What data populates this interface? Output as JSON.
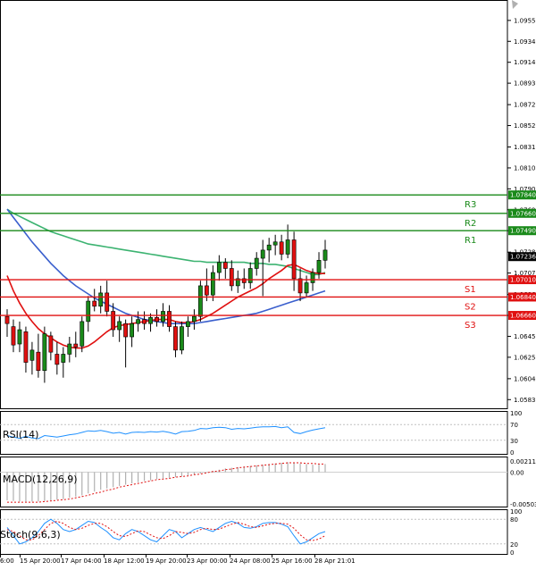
{
  "chart_data": {
    "type": "candlestick",
    "instrument_scale": "EURUSD",
    "main": {
      "ylim": [
        1.0575,
        1.0975
      ],
      "yticks": [
        "1.09550",
        "1.09345",
        "1.09140",
        "1.08935",
        "1.08725",
        "1.08520",
        "1.08310",
        "1.08105",
        "1.07900",
        "1.07695",
        "1.07490",
        "1.07280",
        "1.07075",
        "1.06865",
        "1.06660",
        "1.06455",
        "1.06250",
        "1.06040",
        "1.05835"
      ],
      "levels": [
        {
          "label": "R3",
          "value": 1.0784,
          "tag": "1.07840",
          "color": "#1a8a1a"
        },
        {
          "label": "R2",
          "value": 1.0766,
          "tag": "1.07660",
          "color": "#1a8a1a"
        },
        {
          "label": "R1",
          "value": 1.0749,
          "tag": "1.07490",
          "color": "#1a8a1a"
        },
        {
          "label": "S1",
          "value": 1.0701,
          "tag": "1.07010",
          "color": "#e01010"
        },
        {
          "label": "S2",
          "value": 1.0684,
          "tag": "1.06840",
          "color": "#e01010"
        },
        {
          "label": "S3",
          "value": 1.0666,
          "tag": "1.06660",
          "color": "#e01010"
        }
      ],
      "current_price": "1.07236",
      "candles": [
        [
          1.0665,
          1.0672,
          1.0645,
          1.0658
        ],
        [
          1.0655,
          1.0662,
          1.063,
          1.0637
        ],
        [
          1.0638,
          1.066,
          1.063,
          1.0652
        ],
        [
          1.065,
          1.0655,
          1.061,
          1.062
        ],
        [
          1.0622,
          1.064,
          1.0608,
          1.0632
        ],
        [
          1.063,
          1.0648,
          1.0605,
          1.0612
        ],
        [
          1.0612,
          1.0655,
          1.06,
          1.0648
        ],
        [
          1.0646,
          1.065,
          1.0622,
          1.063
        ],
        [
          1.0628,
          1.064,
          1.0608,
          1.0618
        ],
        [
          1.062,
          1.0635,
          1.0605,
          1.0628
        ],
        [
          1.0628,
          1.0645,
          1.062,
          1.0638
        ],
        [
          1.0638,
          1.065,
          1.0625,
          1.0635
        ],
        [
          1.0636,
          1.0665,
          1.063,
          1.066
        ],
        [
          1.066,
          1.0685,
          1.065,
          1.068
        ],
        [
          1.068,
          1.0692,
          1.067,
          1.0675
        ],
        [
          1.0675,
          1.0695,
          1.0668,
          1.0688
        ],
        [
          1.0688,
          1.07,
          1.0665,
          1.067
        ],
        [
          1.067,
          1.0678,
          1.0645,
          1.0652
        ],
        [
          1.0652,
          1.0665,
          1.064,
          1.066
        ],
        [
          1.0658,
          1.0662,
          1.0615,
          1.0645
        ],
        [
          1.0645,
          1.0665,
          1.0635,
          1.0658
        ],
        [
          1.0658,
          1.067,
          1.065,
          1.0662
        ],
        [
          1.0662,
          1.067,
          1.0652,
          1.0658
        ],
        [
          1.0658,
          1.0668,
          1.065,
          1.0664
        ],
        [
          1.0664,
          1.0672,
          1.0655,
          1.066
        ],
        [
          1.066,
          1.0678,
          1.0655,
          1.067
        ],
        [
          1.067,
          1.0676,
          1.065,
          1.0655
        ],
        [
          1.0655,
          1.066,
          1.0625,
          1.0632
        ],
        [
          1.0632,
          1.066,
          1.0628,
          1.0655
        ],
        [
          1.0655,
          1.0665,
          1.0645,
          1.066
        ],
        [
          1.066,
          1.0672,
          1.0652,
          1.0665
        ],
        [
          1.0665,
          1.07,
          1.066,
          1.0695
        ],
        [
          1.0695,
          1.0712,
          1.068,
          1.0686
        ],
        [
          1.0686,
          1.0715,
          1.068,
          1.0708
        ],
        [
          1.0708,
          1.0725,
          1.07,
          1.0718
        ],
        [
          1.0718,
          1.0722,
          1.0702,
          1.0712
        ],
        [
          1.0712,
          1.072,
          1.069,
          1.0695
        ],
        [
          1.0695,
          1.071,
          1.0688,
          1.0702
        ],
        [
          1.0702,
          1.0712,
          1.0692,
          1.0698
        ],
        [
          1.0698,
          1.0718,
          1.0692,
          1.0712
        ],
        [
          1.0712,
          1.0728,
          1.0705,
          1.0722
        ],
        [
          1.0722,
          1.074,
          1.0685,
          1.073
        ],
        [
          1.073,
          1.0742,
          1.0718,
          1.0735
        ],
        [
          1.0735,
          1.0745,
          1.0725,
          1.0738
        ],
        [
          1.0738,
          1.0745,
          1.072,
          1.0726
        ],
        [
          1.0726,
          1.0755,
          1.0722,
          1.074
        ],
        [
          1.074,
          1.0748,
          1.069,
          1.0702
        ],
        [
          1.0702,
          1.0712,
          1.068,
          1.0688
        ],
        [
          1.0688,
          1.0705,
          1.0684,
          1.0698
        ],
        [
          1.0698,
          1.0712,
          1.069,
          1.0708
        ],
        [
          1.0708,
          1.0728,
          1.0702,
          1.072
        ],
        [
          1.072,
          1.074,
          1.0712,
          1.073
        ]
      ],
      "ma_slow": [
        1.077,
        1.0766,
        1.0763,
        1.076,
        1.0757,
        1.0754,
        1.0751,
        1.0748,
        1.0746,
        1.0744,
        1.0742,
        1.074,
        1.0738,
        1.0736,
        1.0735,
        1.0734,
        1.0733,
        1.0732,
        1.0731,
        1.073,
        1.0729,
        1.0728,
        1.0727,
        1.0726,
        1.0725,
        1.0724,
        1.0723,
        1.0722,
        1.0721,
        1.072,
        1.0719,
        1.0719,
        1.0718,
        1.0718,
        1.0718,
        1.0718,
        1.0718,
        1.0718,
        1.0718,
        1.0717,
        1.0717,
        1.0717,
        1.0716,
        1.0716,
        1.0715,
        1.0714,
        1.0712,
        1.071,
        1.0708,
        1.0706,
        1.0706,
        1.0708
      ],
      "ma_mid": [
        1.077,
        1.0762,
        1.0754,
        1.0746,
        1.0738,
        1.0731,
        1.0724,
        1.0717,
        1.0711,
        1.0705,
        1.07,
        1.0695,
        1.0691,
        1.0687,
        1.0683,
        1.068,
        1.0677,
        1.0674,
        1.0671,
        1.0668,
        1.0666,
        1.0664,
        1.0662,
        1.0661,
        1.066,
        1.0659,
        1.0658,
        1.0658,
        1.0658,
        1.0658,
        1.0658,
        1.0659,
        1.066,
        1.0661,
        1.0662,
        1.0663,
        1.0664,
        1.0665,
        1.0666,
        1.0667,
        1.0668,
        1.067,
        1.0672,
        1.0674,
        1.0676,
        1.0678,
        1.068,
        1.0682,
        1.0684,
        1.0686,
        1.0688,
        1.069
      ],
      "ma_fast": [
        1.0705,
        1.069,
        1.0678,
        1.0668,
        1.066,
        1.0653,
        1.0648,
        1.0644,
        1.064,
        1.0637,
        1.0635,
        1.0634,
        1.0634,
        1.0636,
        1.064,
        1.0645,
        1.065,
        1.0654,
        1.0656,
        1.0657,
        1.0658,
        1.0659,
        1.066,
        1.0661,
        1.0662,
        1.0662,
        1.0662,
        1.066,
        1.0659,
        1.0659,
        1.066,
        1.0662,
        1.0665,
        1.0668,
        1.0672,
        1.0676,
        1.068,
        1.0684,
        1.0687,
        1.069,
        1.0693,
        1.0697,
        1.0702,
        1.0706,
        1.071,
        1.0715,
        1.0716,
        1.0713,
        1.071,
        1.0708,
        1.0707,
        1.0707
      ]
    },
    "rsi": {
      "label": "RSI(14)",
      "ylim": [
        0,
        100
      ],
      "yticks": [
        "100",
        "70",
        "30",
        "0"
      ],
      "values": [
        42,
        38,
        35,
        40,
        36,
        34,
        42,
        40,
        38,
        41,
        44,
        46,
        50,
        54,
        53,
        55,
        52,
        48,
        50,
        46,
        50,
        51,
        50,
        52,
        51,
        53,
        50,
        46,
        52,
        53,
        55,
        60,
        59,
        62,
        63,
        62,
        58,
        60,
        59,
        61,
        63,
        64,
        64,
        65,
        62,
        64,
        50,
        47,
        52,
        56,
        59,
        62
      ]
    },
    "macd": {
      "label": "MACD(12,26,9)",
      "ylim": [
        -0.00055,
        0.00025
      ],
      "yticks": [
        "0.002111",
        "0.00",
        "-0.005039"
      ],
      "hist": [
        -0.00045,
        -0.00046,
        -0.00047,
        -0.00047,
        -0.00047,
        -0.00047,
        -0.00046,
        -0.00045,
        -0.00044,
        -0.00043,
        -0.00041,
        -0.00039,
        -0.00037,
        -0.00034,
        -0.00031,
        -0.00028,
        -0.00026,
        -0.00024,
        -0.00022,
        -0.0002,
        -0.00018,
        -0.00016,
        -0.00014,
        -0.00013,
        -0.00011,
        -0.0001,
        -9e-05,
        -8e-05,
        -7e-05,
        -5e-05,
        -4e-05,
        -2e-05,
        0.0,
        2e-05,
        4e-05,
        6e-05,
        7e-05,
        8e-05,
        9e-05,
        0.0001,
        0.00011,
        0.00012,
        0.00013,
        0.00014,
        0.00015,
        0.00016,
        0.00015,
        0.00014,
        0.00013,
        0.00012,
        0.00012,
        0.00013
      ],
      "signal": [
        -0.00048,
        -0.00048,
        -0.00048,
        -0.00048,
        -0.00048,
        -0.00048,
        -0.00047,
        -0.00046,
        -0.00045,
        -0.00044,
        -0.00043,
        -0.00041,
        -0.00039,
        -0.00037,
        -0.00034,
        -0.00032,
        -0.00029,
        -0.00027,
        -0.00024,
        -0.00022,
        -0.0002,
        -0.00018,
        -0.00016,
        -0.00014,
        -0.00012,
        -0.00011,
        -0.0001,
        -8e-05,
        -7e-05,
        -6e-05,
        -4e-05,
        -3e-05,
        -1e-05,
        1e-05,
        2e-05,
        4e-05,
        5e-05,
        7e-05,
        8e-05,
        9e-05,
        0.0001,
        0.00011,
        0.00012,
        0.00013,
        0.00014,
        0.00015,
        0.00015,
        0.00015,
        0.00014,
        0.00014,
        0.00013,
        0.00013
      ]
    },
    "stoch": {
      "label": "Stoch(9,6,3)",
      "ylim": [
        0,
        100
      ],
      "yticks": [
        "100",
        "80",
        "20",
        "0"
      ],
      "k": [
        60,
        40,
        20,
        25,
        35,
        50,
        70,
        80,
        70,
        55,
        50,
        55,
        65,
        75,
        72,
        60,
        50,
        35,
        30,
        45,
        55,
        50,
        40,
        30,
        25,
        40,
        55,
        50,
        35,
        45,
        55,
        60,
        55,
        50,
        60,
        70,
        75,
        70,
        60,
        58,
        62,
        70,
        72,
        72,
        68,
        62,
        40,
        20,
        25,
        35,
        45,
        50
      ],
      "d": [
        55,
        50,
        40,
        30,
        30,
        40,
        55,
        70,
        75,
        70,
        60,
        55,
        58,
        65,
        70,
        70,
        62,
        50,
        40,
        38,
        45,
        52,
        50,
        42,
        35,
        33,
        40,
        50,
        48,
        45,
        48,
        55,
        58,
        55,
        56,
        62,
        68,
        72,
        68,
        62,
        60,
        64,
        68,
        70,
        70,
        68,
        58,
        42,
        30,
        28,
        32,
        40
      ]
    },
    "x_axis": {
      "labels": [
        "6:00",
        "15 Apr 20:00",
        "17 Apr 04:00",
        "18 Apr 12:00",
        "19 Apr 20:00",
        "23 Apr 00:00",
        "24 Apr 08:00",
        "25 Apr 16:00",
        "28 Apr 21:01"
      ]
    },
    "colors": {
      "bull": "#1a8a1a",
      "bear": "#e01010",
      "ma_slow": "#3cb371",
      "ma_mid": "#3a5fcd",
      "ma_fast": "#e01010",
      "rsi": "#1e90ff",
      "macd_hist": "#b0b0b0",
      "macd_signal": "#e01010",
      "stoch_k": "#1e90ff",
      "stoch_d": "#e01010",
      "support": "#e01010",
      "resistance": "#1a8a1a"
    }
  }
}
